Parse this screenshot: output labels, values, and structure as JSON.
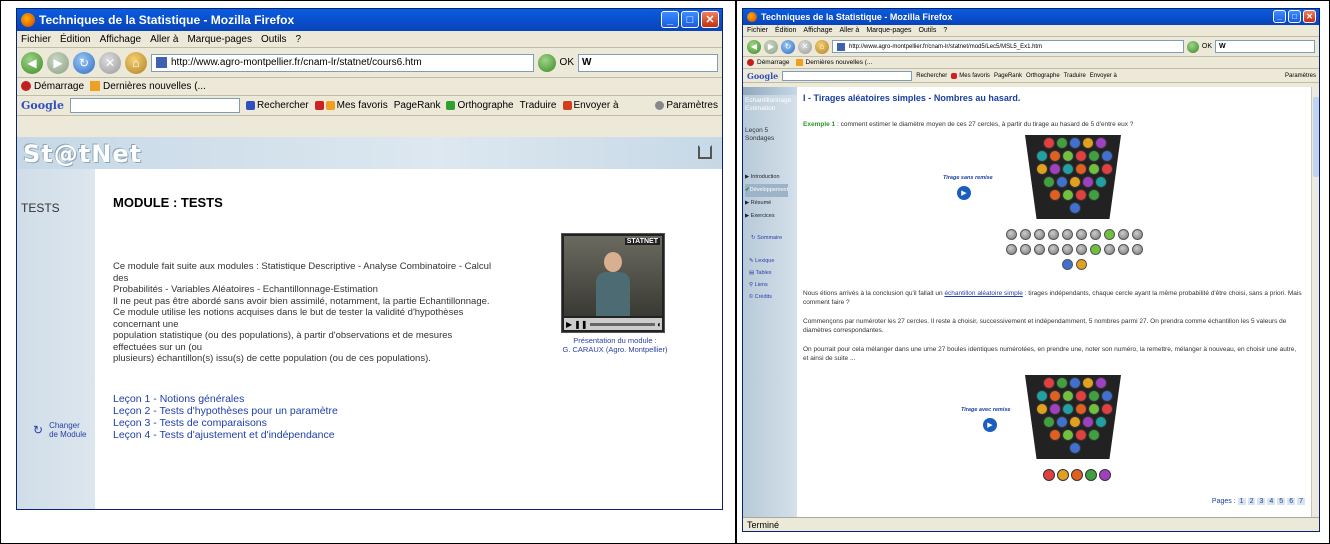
{
  "left": {
    "window_title": "Techniques de la Statistique - Mozilla Firefox",
    "menu": [
      "Fichier",
      "Édition",
      "Affichage",
      "Aller à",
      "Marque-pages",
      "Outils",
      "?"
    ],
    "url": "http://www.agro-montpellier.fr/cnam-lr/statnet/cours6.htm",
    "ok_label": "OK",
    "search_value": "W",
    "bookmarks": [
      "Démarrage",
      "Dernières nouvelles (..."
    ],
    "google_label": "Google",
    "google_tools": [
      "Rechercher",
      "Mes favoris",
      "PageRank",
      "Orthographe",
      "Traduire",
      "Envoyer à",
      "Paramètres"
    ],
    "logo": "St@tNet",
    "side_title": "TESTS",
    "module_title": "MODULE : TESTS",
    "intro_lines": [
      "Ce module fait suite aux modules : Statistique Descriptive - Analyse Combinatoire - Calcul des",
      "Probabilités - Variables Aléatoires - Echantillonnage-Estimation",
      "Il ne peut pas être abordé sans avoir bien assimilé, notamment, la partie Echantillonnage.",
      "Ce module utilise les notions acquises dans le but de tester la validité d'hypothèses concernant une",
      "population statistique (ou des populations), à partir d'observations et de mesures effectuées sur un (ou",
      "plusieurs) échantillon(s) issu(s) de cette population (ou de ces populations)."
    ],
    "video_badge": "STATNET",
    "video_caption_1": "Présentation du module :",
    "video_caption_2": "G. CARAUX (Agro. Montpellier)",
    "lessons": [
      "Leçon 1 - Notions générales",
      "Leçon 2 - Tests d'hypothèses pour un paramètre",
      "Leçon 3 - Tests de comparaisons",
      "Leçon 4 - Tests d'ajustement et d'indépendance"
    ],
    "change_module_1": "Changer",
    "change_module_2": "de Module"
  },
  "right": {
    "window_title": "Techniques de la Statistique - Mozilla Firefox",
    "menu": [
      "Fichier",
      "Édition",
      "Affichage",
      "Aller à",
      "Marque-pages",
      "Outils",
      "?"
    ],
    "url": "http://www.agro-montpellier.fr/cnam-lr/statnet/mod5/Lec5/MSL5_Ex1.htm",
    "ok_label": "OK",
    "search_value": "W",
    "bookmarks": [
      "Démarrage",
      "Dernières nouvelles (..."
    ],
    "google_label": "Google",
    "google_tools": [
      "Rechercher",
      "Mes favoris",
      "PageRank",
      "Orthographe",
      "Traduire",
      "Envoyer à",
      "Paramètres"
    ],
    "side_module": "Echantillonnage Estimation",
    "side_lesson": "Leçon 5 Sondages",
    "nav_items": [
      "Introduction",
      "Développement",
      "Résumé",
      "Exercices"
    ],
    "summary_label": "Sommaire",
    "tools": [
      "Lexique",
      "Tables",
      "Liens",
      "Crédits"
    ],
    "heading": "I - Tirages aléatoires simples - Nombres au hasard.",
    "example_label": "Exemple 1",
    "example_text": " : comment estimer le diamètre moyen de ces 27 cercles, à partir du tirage au hasard de 5 d'entre eux ?",
    "draw_without": "Tirage sans remise",
    "draw_with": "Tirage avec remise",
    "para1_a": "Nous étions arrivés à la conclusion qu'il fallait un ",
    "para1_link": "échantillon aléatoire simple",
    "para1_b": " : tirages indépendants, chaque cercle ayant la même probabilité d'être choisi, sans a priori. Mais comment faire ?",
    "para2": "Commençons par numéroter les 27 cercles. Il reste à choisir, successivement et indépendamment, 5 nombres parmi 27. On prendra comme échantillon les 5 valeurs de diamètres correspondantes.",
    "para3": "On pourrait pour cela mélanger dans une urne 27 boules identiques numérotées, en prendre une, noter son numéro, la remettre, mélanger à nouveau, en choisir une autre, et ainsi de suite ...",
    "pages_label": "Pages :",
    "pages": [
      "1",
      "2",
      "3",
      "4",
      "5",
      "6",
      "7"
    ],
    "status": "Terminé"
  }
}
